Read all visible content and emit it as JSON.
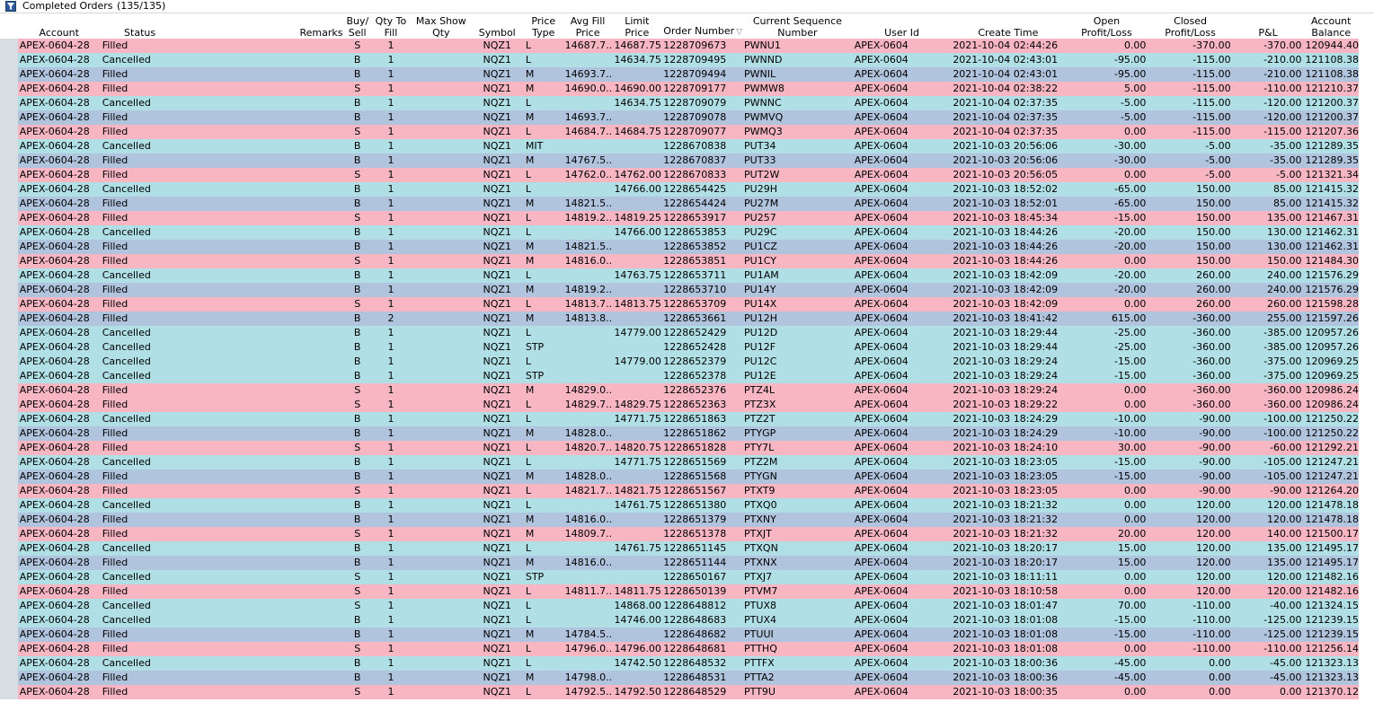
{
  "window": {
    "title": "Completed Orders",
    "count": "(135/135)"
  },
  "colors": {
    "filled": "#f7b6c2",
    "cancelled": "#b0e0e6",
    "buy_market": "#b0c4de"
  },
  "columns": [
    "Account",
    "Status",
    "Remarks",
    "Buy/ Sell",
    "Qty To Fill",
    "Max Show Qty",
    "Symbol",
    "Price Type",
    "Avg Fill Price",
    "Limit Price",
    "Order Number",
    "Current Sequence Number",
    "User Id",
    "Create Time",
    "Open Profit/Loss",
    "Closed Profit/Loss",
    "P&L",
    "Account Balance"
  ],
  "rows": [
    [
      "APEX-0604-28",
      "Filled",
      "",
      "S",
      "1",
      "",
      "NQZ1",
      "L",
      "14687.7...",
      "14687.75",
      "1228709673",
      "PWNU1",
      "APEX-0604",
      "2021-10-04 02:44:26",
      "0.00",
      "-370.00",
      "-370.00",
      "120944.40",
      "filled"
    ],
    [
      "APEX-0604-28",
      "Cancelled",
      "",
      "B",
      "1",
      "",
      "NQZ1",
      "L",
      "",
      "14634.75",
      "1228709495",
      "PWNND",
      "APEX-0604",
      "2021-10-04 02:43:01",
      "-95.00",
      "-115.00",
      "-210.00",
      "121108.38",
      "cancelled"
    ],
    [
      "APEX-0604-28",
      "Filled",
      "",
      "B",
      "1",
      "",
      "NQZ1",
      "M",
      "14693.7...",
      "",
      "1228709494",
      "PWNIL",
      "APEX-0604",
      "2021-10-04 02:43:01",
      "-95.00",
      "-115.00",
      "-210.00",
      "121108.38",
      "buymkt"
    ],
    [
      "APEX-0604-28",
      "Filled",
      "",
      "S",
      "1",
      "",
      "NQZ1",
      "M",
      "14690.0...",
      "14690.00",
      "1228709177",
      "PWMW8",
      "APEX-0604",
      "2021-10-04 02:38:22",
      "5.00",
      "-115.00",
      "-110.00",
      "121210.37",
      "filled"
    ],
    [
      "APEX-0604-28",
      "Cancelled",
      "",
      "B",
      "1",
      "",
      "NQZ1",
      "L",
      "",
      "14634.75",
      "1228709079",
      "PWNNC",
      "APEX-0604",
      "2021-10-04 02:37:35",
      "-5.00",
      "-115.00",
      "-120.00",
      "121200.37",
      "cancelled"
    ],
    [
      "APEX-0604-28",
      "Filled",
      "",
      "B",
      "1",
      "",
      "NQZ1",
      "M",
      "14693.7...",
      "",
      "1228709078",
      "PWMVQ",
      "APEX-0604",
      "2021-10-04 02:37:35",
      "-5.00",
      "-115.00",
      "-120.00",
      "121200.37",
      "buymkt"
    ],
    [
      "APEX-0604-28",
      "Filled",
      "",
      "S",
      "1",
      "",
      "NQZ1",
      "L",
      "14684.7...",
      "14684.75",
      "1228709077",
      "PWMQ3",
      "APEX-0604",
      "2021-10-04 02:37:35",
      "0.00",
      "-115.00",
      "-115.00",
      "121207.36",
      "filled"
    ],
    [
      "APEX-0604-28",
      "Cancelled",
      "",
      "B",
      "1",
      "",
      "NQZ1",
      "MIT",
      "",
      "",
      "1228670838",
      "PUT34",
      "APEX-0604",
      "2021-10-03 20:56:06",
      "-30.00",
      "-5.00",
      "-35.00",
      "121289.35",
      "cancelled"
    ],
    [
      "APEX-0604-28",
      "Filled",
      "",
      "B",
      "1",
      "",
      "NQZ1",
      "M",
      "14767.5...",
      "",
      "1228670837",
      "PUT33",
      "APEX-0604",
      "2021-10-03 20:56:06",
      "-30.00",
      "-5.00",
      "-35.00",
      "121289.35",
      "buymkt"
    ],
    [
      "APEX-0604-28",
      "Filled",
      "",
      "S",
      "1",
      "",
      "NQZ1",
      "L",
      "14762.0...",
      "14762.00",
      "1228670833",
      "PUT2W",
      "APEX-0604",
      "2021-10-03 20:56:05",
      "0.00",
      "-5.00",
      "-5.00",
      "121321.34",
      "filled"
    ],
    [
      "APEX-0604-28",
      "Cancelled",
      "",
      "B",
      "1",
      "",
      "NQZ1",
      "L",
      "",
      "14766.00",
      "1228654425",
      "PU29H",
      "APEX-0604",
      "2021-10-03 18:52:02",
      "-65.00",
      "150.00",
      "85.00",
      "121415.32",
      "cancelled"
    ],
    [
      "APEX-0604-28",
      "Filled",
      "",
      "B",
      "1",
      "",
      "NQZ1",
      "M",
      "14821.5...",
      "",
      "1228654424",
      "PU27M",
      "APEX-0604",
      "2021-10-03 18:52:01",
      "-65.00",
      "150.00",
      "85.00",
      "121415.32",
      "buymkt"
    ],
    [
      "APEX-0604-28",
      "Filled",
      "",
      "S",
      "1",
      "",
      "NQZ1",
      "L",
      "14819.2...",
      "14819.25",
      "1228653917",
      "PU257",
      "APEX-0604",
      "2021-10-03 18:45:34",
      "-15.00",
      "150.00",
      "135.00",
      "121467.31",
      "filled"
    ],
    [
      "APEX-0604-28",
      "Cancelled",
      "",
      "B",
      "1",
      "",
      "NQZ1",
      "L",
      "",
      "14766.00",
      "1228653853",
      "PU29C",
      "APEX-0604",
      "2021-10-03 18:44:26",
      "-20.00",
      "150.00",
      "130.00",
      "121462.31",
      "cancelled"
    ],
    [
      "APEX-0604-28",
      "Filled",
      "",
      "B",
      "1",
      "",
      "NQZ1",
      "M",
      "14821.5...",
      "",
      "1228653852",
      "PU1CZ",
      "APEX-0604",
      "2021-10-03 18:44:26",
      "-20.00",
      "150.00",
      "130.00",
      "121462.31",
      "buymkt"
    ],
    [
      "APEX-0604-28",
      "Filled",
      "",
      "S",
      "1",
      "",
      "NQZ1",
      "M",
      "14816.0...",
      "",
      "1228653851",
      "PU1CY",
      "APEX-0604",
      "2021-10-03 18:44:26",
      "0.00",
      "150.00",
      "150.00",
      "121484.30",
      "filled"
    ],
    [
      "APEX-0604-28",
      "Cancelled",
      "",
      "B",
      "1",
      "",
      "NQZ1",
      "L",
      "",
      "14763.75",
      "1228653711",
      "PU1AM",
      "APEX-0604",
      "2021-10-03 18:42:09",
      "-20.00",
      "260.00",
      "240.00",
      "121576.29",
      "cancelled"
    ],
    [
      "APEX-0604-28",
      "Filled",
      "",
      "B",
      "1",
      "",
      "NQZ1",
      "M",
      "14819.2...",
      "",
      "1228653710",
      "PU14Y",
      "APEX-0604",
      "2021-10-03 18:42:09",
      "-20.00",
      "260.00",
      "240.00",
      "121576.29",
      "buymkt"
    ],
    [
      "APEX-0604-28",
      "Filled",
      "",
      "S",
      "1",
      "",
      "NQZ1",
      "L",
      "14813.7...",
      "14813.75",
      "1228653709",
      "PU14X",
      "APEX-0604",
      "2021-10-03 18:42:09",
      "0.00",
      "260.00",
      "260.00",
      "121598.28",
      "filled"
    ],
    [
      "APEX-0604-28",
      "Filled",
      "",
      "B",
      "2",
      "",
      "NQZ1",
      "M",
      "14813.8...",
      "",
      "1228653661",
      "PU12H",
      "APEX-0604",
      "2021-10-03 18:41:42",
      "615.00",
      "-360.00",
      "255.00",
      "121597.26",
      "buymkt"
    ],
    [
      "APEX-0604-28",
      "Cancelled",
      "",
      "B",
      "1",
      "",
      "NQZ1",
      "L",
      "",
      "14779.00",
      "1228652429",
      "PU12D",
      "APEX-0604",
      "2021-10-03 18:29:44",
      "-25.00",
      "-360.00",
      "-385.00",
      "120957.26",
      "cancelled"
    ],
    [
      "APEX-0604-28",
      "Cancelled",
      "",
      "B",
      "1",
      "",
      "NQZ1",
      "STP",
      "",
      "",
      "1228652428",
      "PU12F",
      "APEX-0604",
      "2021-10-03 18:29:44",
      "-25.00",
      "-360.00",
      "-385.00",
      "120957.26",
      "cancelled"
    ],
    [
      "APEX-0604-28",
      "Cancelled",
      "",
      "B",
      "1",
      "",
      "NQZ1",
      "L",
      "",
      "14779.00",
      "1228652379",
      "PU12C",
      "APEX-0604",
      "2021-10-03 18:29:24",
      "-15.00",
      "-360.00",
      "-375.00",
      "120969.25",
      "cancelled"
    ],
    [
      "APEX-0604-28",
      "Cancelled",
      "",
      "B",
      "1",
      "",
      "NQZ1",
      "STP",
      "",
      "",
      "1228652378",
      "PU12E",
      "APEX-0604",
      "2021-10-03 18:29:24",
      "-15.00",
      "-360.00",
      "-375.00",
      "120969.25",
      "cancelled"
    ],
    [
      "APEX-0604-28",
      "Filled",
      "",
      "S",
      "1",
      "",
      "NQZ1",
      "M",
      "14829.0...",
      "",
      "1228652376",
      "PTZ4L",
      "APEX-0604",
      "2021-10-03 18:29:24",
      "0.00",
      "-360.00",
      "-360.00",
      "120986.24",
      "filled"
    ],
    [
      "APEX-0604-28",
      "Filled",
      "",
      "S",
      "1",
      "",
      "NQZ1",
      "L",
      "14829.7...",
      "14829.75",
      "1228652363",
      "PTZ3X",
      "APEX-0604",
      "2021-10-03 18:29:22",
      "0.00",
      "-360.00",
      "-360.00",
      "120986.24",
      "filled"
    ],
    [
      "APEX-0604-28",
      "Cancelled",
      "",
      "B",
      "1",
      "",
      "NQZ1",
      "L",
      "",
      "14771.75",
      "1228651863",
      "PTZ2T",
      "APEX-0604",
      "2021-10-03 18:24:29",
      "-10.00",
      "-90.00",
      "-100.00",
      "121250.22",
      "cancelled"
    ],
    [
      "APEX-0604-28",
      "Filled",
      "",
      "B",
      "1",
      "",
      "NQZ1",
      "M",
      "14828.0...",
      "",
      "1228651862",
      "PTYGP",
      "APEX-0604",
      "2021-10-03 18:24:29",
      "-10.00",
      "-90.00",
      "-100.00",
      "121250.22",
      "buymkt"
    ],
    [
      "APEX-0604-28",
      "Filled",
      "",
      "S",
      "1",
      "",
      "NQZ1",
      "L",
      "14820.7...",
      "14820.75",
      "1228651828",
      "PTY7L",
      "APEX-0604",
      "2021-10-03 18:24:10",
      "30.00",
      "-90.00",
      "-60.00",
      "121292.21",
      "filled"
    ],
    [
      "APEX-0604-28",
      "Cancelled",
      "",
      "B",
      "1",
      "",
      "NQZ1",
      "L",
      "",
      "14771.75",
      "1228651569",
      "PTZ2M",
      "APEX-0604",
      "2021-10-03 18:23:05",
      "-15.00",
      "-90.00",
      "-105.00",
      "121247.21",
      "cancelled"
    ],
    [
      "APEX-0604-28",
      "Filled",
      "",
      "B",
      "1",
      "",
      "NQZ1",
      "M",
      "14828.0...",
      "",
      "1228651568",
      "PTYGN",
      "APEX-0604",
      "2021-10-03 18:23:05",
      "-15.00",
      "-90.00",
      "-105.00",
      "121247.21",
      "buymkt"
    ],
    [
      "APEX-0604-28",
      "Filled",
      "",
      "S",
      "1",
      "",
      "NQZ1",
      "L",
      "14821.7...",
      "14821.75",
      "1228651567",
      "PTXT9",
      "APEX-0604",
      "2021-10-03 18:23:05",
      "0.00",
      "-90.00",
      "-90.00",
      "121264.20",
      "filled"
    ],
    [
      "APEX-0604-28",
      "Cancelled",
      "",
      "B",
      "1",
      "",
      "NQZ1",
      "L",
      "",
      "14761.75",
      "1228651380",
      "PTXQ0",
      "APEX-0604",
      "2021-10-03 18:21:32",
      "0.00",
      "120.00",
      "120.00",
      "121478.18",
      "cancelled"
    ],
    [
      "APEX-0604-28",
      "Filled",
      "",
      "B",
      "1",
      "",
      "NQZ1",
      "M",
      "14816.0...",
      "",
      "1228651379",
      "PTXNY",
      "APEX-0604",
      "2021-10-03 18:21:32",
      "0.00",
      "120.00",
      "120.00",
      "121478.18",
      "buymkt"
    ],
    [
      "APEX-0604-28",
      "Filled",
      "",
      "S",
      "1",
      "",
      "NQZ1",
      "M",
      "14809.7...",
      "",
      "1228651378",
      "PTXJT",
      "APEX-0604",
      "2021-10-03 18:21:32",
      "20.00",
      "120.00",
      "140.00",
      "121500.17",
      "filled"
    ],
    [
      "APEX-0604-28",
      "Cancelled",
      "",
      "B",
      "1",
      "",
      "NQZ1",
      "L",
      "",
      "14761.75",
      "1228651145",
      "PTXQN",
      "APEX-0604",
      "2021-10-03 18:20:17",
      "15.00",
      "120.00",
      "135.00",
      "121495.17",
      "cancelled"
    ],
    [
      "APEX-0604-28",
      "Filled",
      "",
      "B",
      "1",
      "",
      "NQZ1",
      "M",
      "14816.0...",
      "",
      "1228651144",
      "PTXNX",
      "APEX-0604",
      "2021-10-03 18:20:17",
      "15.00",
      "120.00",
      "135.00",
      "121495.17",
      "buymkt"
    ],
    [
      "APEX-0604-28",
      "Cancelled",
      "",
      "S",
      "1",
      "",
      "NQZ1",
      "STP",
      "",
      "",
      "1228650167",
      "PTXJ7",
      "APEX-0604",
      "2021-10-03 18:11:11",
      "0.00",
      "120.00",
      "120.00",
      "121482.16",
      "cancelled"
    ],
    [
      "APEX-0604-28",
      "Filled",
      "",
      "S",
      "1",
      "",
      "NQZ1",
      "L",
      "14811.7...",
      "14811.75",
      "1228650139",
      "PTVM7",
      "APEX-0604",
      "2021-10-03 18:10:58",
      "0.00",
      "120.00",
      "120.00",
      "121482.16",
      "filled"
    ],
    [
      "APEX-0604-28",
      "Cancelled",
      "",
      "S",
      "1",
      "",
      "NQZ1",
      "L",
      "",
      "14868.00",
      "1228648812",
      "PTUX8",
      "APEX-0604",
      "2021-10-03 18:01:47",
      "70.00",
      "-110.00",
      "-40.00",
      "121324.15",
      "cancelled"
    ],
    [
      "APEX-0604-28",
      "Cancelled",
      "",
      "B",
      "1",
      "",
      "NQZ1",
      "L",
      "",
      "14746.00",
      "1228648683",
      "PTUX4",
      "APEX-0604",
      "2021-10-03 18:01:08",
      "-15.00",
      "-110.00",
      "-125.00",
      "121239.15",
      "cancelled"
    ],
    [
      "APEX-0604-28",
      "Filled",
      "",
      "B",
      "1",
      "",
      "NQZ1",
      "M",
      "14784.5...",
      "",
      "1228648682",
      "PTUUI",
      "APEX-0604",
      "2021-10-03 18:01:08",
      "-15.00",
      "-110.00",
      "-125.00",
      "121239.15",
      "buymkt"
    ],
    [
      "APEX-0604-28",
      "Filled",
      "",
      "S",
      "1",
      "",
      "NQZ1",
      "L",
      "14796.0...",
      "14796.00",
      "1228648681",
      "PTTHQ",
      "APEX-0604",
      "2021-10-03 18:01:08",
      "0.00",
      "-110.00",
      "-110.00",
      "121256.14",
      "filled"
    ],
    [
      "APEX-0604-28",
      "Cancelled",
      "",
      "B",
      "1",
      "",
      "NQZ1",
      "L",
      "",
      "14742.50",
      "1228648532",
      "PTTFX",
      "APEX-0604",
      "2021-10-03 18:00:36",
      "-45.00",
      "0.00",
      "-45.00",
      "121323.13",
      "cancelled"
    ],
    [
      "APEX-0604-28",
      "Filled",
      "",
      "B",
      "1",
      "",
      "NQZ1",
      "M",
      "14798.0...",
      "",
      "1228648531",
      "PTTA2",
      "APEX-0604",
      "2021-10-03 18:00:36",
      "-45.00",
      "0.00",
      "-45.00",
      "121323.13",
      "buymkt"
    ],
    [
      "APEX-0604-28",
      "Filled",
      "",
      "S",
      "1",
      "",
      "NQZ1",
      "L",
      "14792.5...",
      "14792.50",
      "1228648529",
      "PTT9U",
      "APEX-0604",
      "2021-10-03 18:00:35",
      "0.00",
      "0.00",
      "0.00",
      "121370.12",
      "filled"
    ]
  ]
}
